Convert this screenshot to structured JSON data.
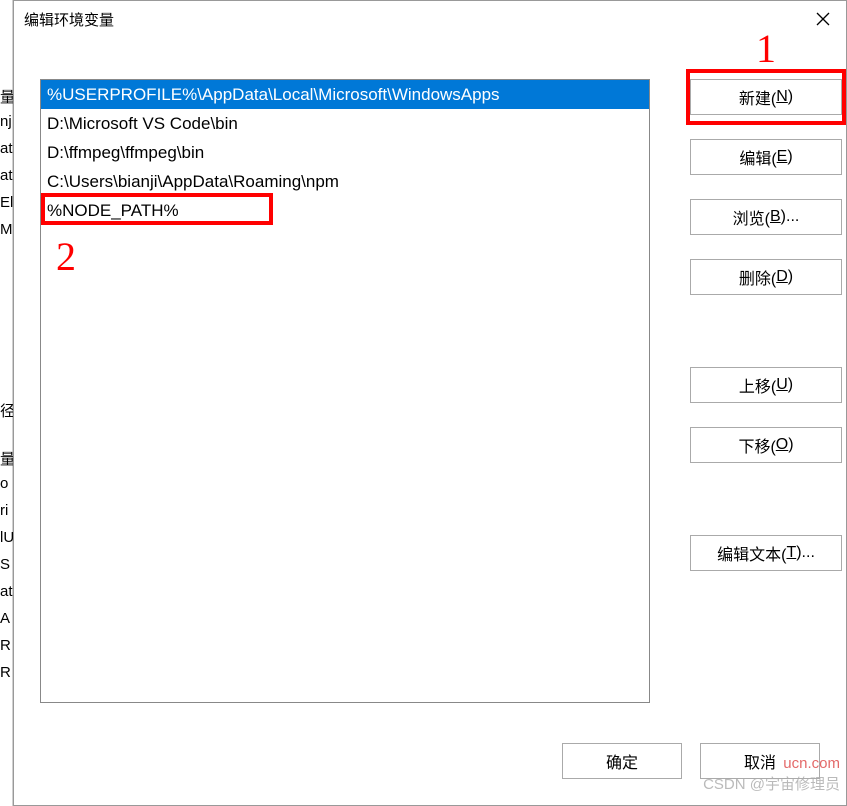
{
  "dialog": {
    "title": "编辑环境变量"
  },
  "list": {
    "items": [
      {
        "text": "%USERPROFILE%\\AppData\\Local\\Microsoft\\WindowsApps",
        "selected": true
      },
      {
        "text": "D:\\Microsoft VS Code\\bin",
        "selected": false
      },
      {
        "text": "D:\\ffmpeg\\ffmpeg\\bin",
        "selected": false
      },
      {
        "text": "C:\\Users\\bianji\\AppData\\Roaming\\npm",
        "selected": false
      },
      {
        "text": "%NODE_PATH%",
        "selected": false
      }
    ]
  },
  "buttons": {
    "new": {
      "pre": "新建(",
      "u": "N",
      "post": ")"
    },
    "edit": {
      "pre": "编辑(",
      "u": "E",
      "post": ")"
    },
    "browse": {
      "pre": "浏览(",
      "u": "B",
      "post": ")..."
    },
    "delete": {
      "pre": "删除(",
      "u": "D",
      "post": ")"
    },
    "moveup": {
      "pre": "上移(",
      "u": "U",
      "post": ")"
    },
    "movedown": {
      "pre": "下移(",
      "u": "O",
      "post": ")"
    },
    "edittext": {
      "pre": "编辑文本(",
      "u": "T",
      "post": ")..."
    },
    "ok": "确定",
    "cancel": "取消"
  },
  "annotations": {
    "n1": "1",
    "n2": "2"
  },
  "watermark": {
    "line1": "ucn.com",
    "line2": "CSDN @宇宙修理员"
  },
  "bgLetters": [
    "量",
    "nj",
    "at",
    "at",
    "El",
    "M",
    "径",
    "量",
    "o",
    "ri",
    "lU",
    "S",
    "at",
    "A",
    "R",
    "R"
  ]
}
